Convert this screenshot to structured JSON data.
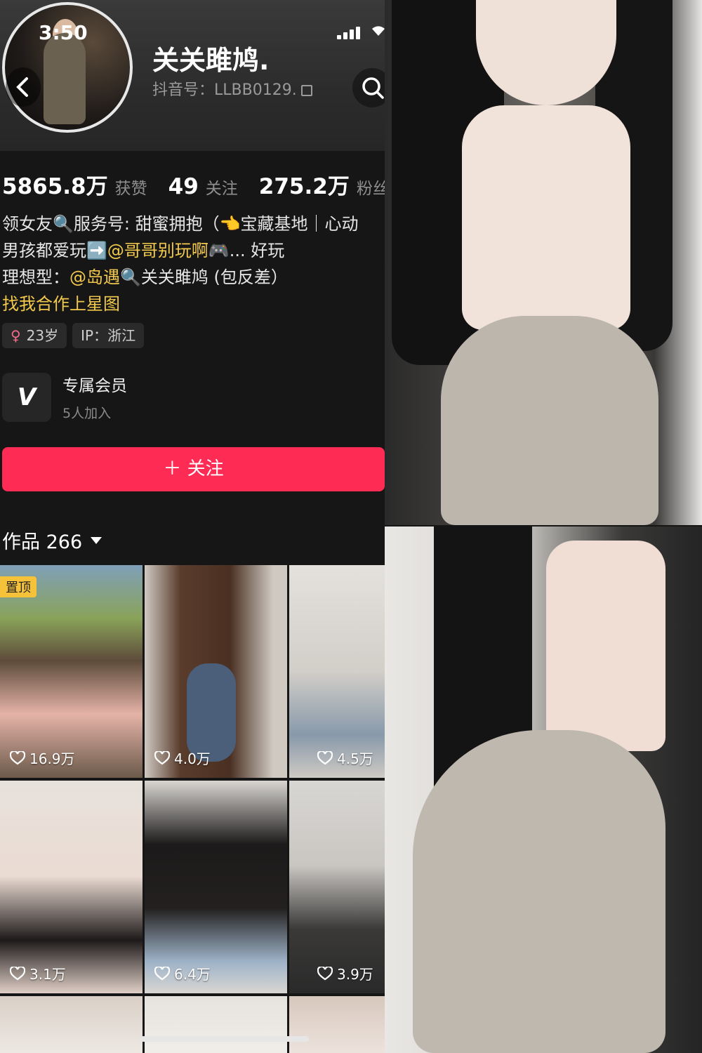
{
  "status": {
    "time": "3:50"
  },
  "profile": {
    "username": "关关雎鸠.",
    "douyin_id": "抖音号：LLBB0129.",
    "stats": [
      {
        "value": "5865.8万",
        "label": "获赞"
      },
      {
        "value": "49",
        "label": "关注"
      },
      {
        "value": "275.2万",
        "label": "粉丝"
      }
    ],
    "bio": {
      "line1": "领女友🔍服务号: 甜蜜拥抱（👈宝藏基地｜心动",
      "line2_prefix": "男孩都爱玩➡️",
      "line2_mention": "@哥哥别玩啊🎮",
      "line2_suffix": "... 好玩",
      "line3_prefix": "理想型：",
      "line3_mention": "@岛遇🔍",
      "line3_suffix": "关关雎鸠 (包反差）",
      "line4": "找我合作上星图"
    },
    "tags": {
      "age": "23岁",
      "ip": "IP：浙江"
    },
    "member": {
      "title": "专属会员",
      "subtitle": "5人加入"
    },
    "follow_label": "＋ 关注",
    "works_label": "作品 266"
  },
  "videos": [
    {
      "likes": "16.9万",
      "pinned": "置顶"
    },
    {
      "likes": "4.0万"
    },
    {
      "likes": "4.5万"
    },
    {
      "likes": "3.1万"
    },
    {
      "likes": "6.4万"
    },
    {
      "likes": "3.9万"
    }
  ]
}
